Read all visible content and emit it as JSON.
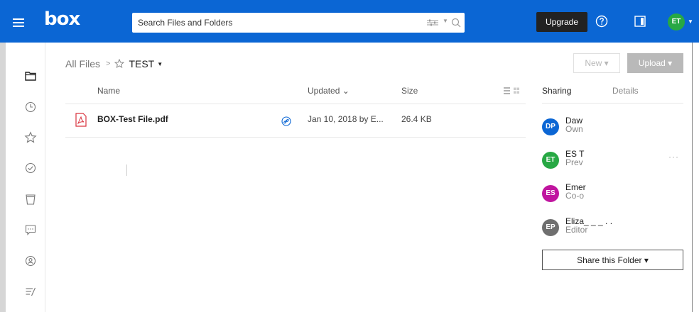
{
  "header": {
    "logo": "box",
    "search_placeholder": "Search Files and Folders",
    "upgrade_label": "Upgrade",
    "user_initials": "ET"
  },
  "breadcrumb": {
    "root": "All Files",
    "separator": ">",
    "current": "TEST"
  },
  "toolbar": {
    "new_label": "New ▾",
    "upload_label": "Upload ▾"
  },
  "columns": {
    "name": "Name",
    "updated": "Updated ⌄",
    "size": "Size"
  },
  "files": [
    {
      "name": "BOX-Test File.pdf",
      "updated": "Jan 10, 2018 by E...",
      "size": "26.4 KB",
      "icon": "pdf-icon"
    }
  ],
  "sidebar_tabs": {
    "sharing": "Sharing",
    "details": "Details"
  },
  "collaborators": [
    {
      "initials": "DP",
      "name": "Daw",
      "role": "Own",
      "color": "#0b66d4"
    },
    {
      "initials": "ET",
      "name": "ES T",
      "role": "Prev",
      "color": "#27a844"
    },
    {
      "initials": "ES",
      "name": "Emer",
      "role": "Co-o",
      "color": "#c0159f"
    },
    {
      "initials": "EP",
      "name": "Eliza_ _ _ . .",
      "role": "Editor",
      "color": "#6f6f6f"
    }
  ],
  "share_button": "Share this Folder ▾",
  "more_label": "···",
  "colors": {
    "brand": "#0b66d4",
    "upgrade": "#222222"
  }
}
